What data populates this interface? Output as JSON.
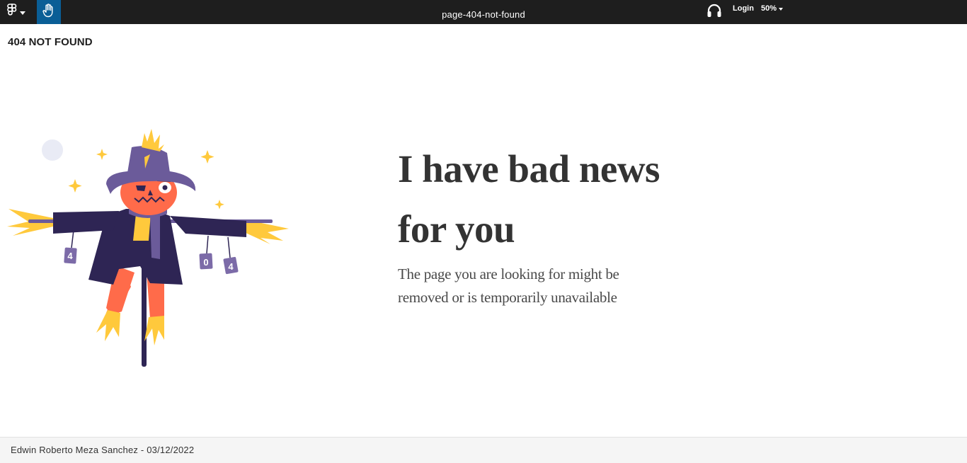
{
  "toolbar": {
    "menu_icon": "figma-logo-icon",
    "hand_icon": "hand-tool-icon",
    "file_name": "page-404-not-found",
    "audio_icon": "headphones-icon",
    "login_label": "Login",
    "zoom_label": "50%"
  },
  "frame": {
    "label": "404 NOT FOUND"
  },
  "illustration": {
    "icon": "scarecrow-illustration",
    "cans": [
      "4",
      "0",
      "4"
    ]
  },
  "content": {
    "headline_line1": "I have bad news",
    "headline_line2": "for you",
    "sub_line1": "The page you are looking for might be",
    "sub_line2": "removed or is temporarily unavailable"
  },
  "footer": {
    "credit": "Edwin Roberto Meza Sanchez - 03/12/2022"
  },
  "colors": {
    "toolbar_bg": "#1e1e1e",
    "active_tool": "#0a5e96",
    "coat": "#2e2554",
    "hat": "#6b5b9a",
    "pumpkin": "#ff6b4a",
    "straw": "#ffc93c"
  }
}
